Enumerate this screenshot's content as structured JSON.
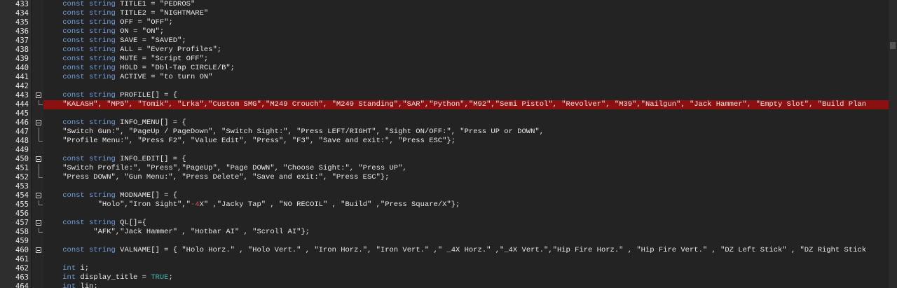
{
  "editor": {
    "lines": [
      {
        "num": "433",
        "fold": "",
        "hl": false,
        "parts": [
          {
            "t": "    ",
            "c": ""
          },
          {
            "t": "const string",
            "c": "kw"
          },
          {
            "t": " TITLE1 = \"PEDROS\"",
            "c": ""
          }
        ]
      },
      {
        "num": "434",
        "fold": "",
        "hl": false,
        "parts": [
          {
            "t": "    ",
            "c": ""
          },
          {
            "t": "const string",
            "c": "kw"
          },
          {
            "t": " TITLE2 = \"NIGHTMARE\"",
            "c": ""
          }
        ]
      },
      {
        "num": "435",
        "fold": "",
        "hl": false,
        "parts": [
          {
            "t": "    ",
            "c": ""
          },
          {
            "t": "const string",
            "c": "kw"
          },
          {
            "t": " OFF = \"OFF\";",
            "c": ""
          }
        ]
      },
      {
        "num": "436",
        "fold": "",
        "hl": false,
        "parts": [
          {
            "t": "    ",
            "c": ""
          },
          {
            "t": "const string",
            "c": "kw"
          },
          {
            "t": " ON = \"ON\";",
            "c": ""
          }
        ]
      },
      {
        "num": "437",
        "fold": "",
        "hl": false,
        "parts": [
          {
            "t": "    ",
            "c": ""
          },
          {
            "t": "const string",
            "c": "kw"
          },
          {
            "t": " SAVE = \"SAVED\";",
            "c": ""
          }
        ]
      },
      {
        "num": "438",
        "fold": "",
        "hl": false,
        "parts": [
          {
            "t": "    ",
            "c": ""
          },
          {
            "t": "const string",
            "c": "kw"
          },
          {
            "t": " ALL = \"Every Profiles\";",
            "c": ""
          }
        ]
      },
      {
        "num": "439",
        "fold": "",
        "hl": false,
        "parts": [
          {
            "t": "    ",
            "c": ""
          },
          {
            "t": "const string",
            "c": "kw"
          },
          {
            "t": " MUTE = \"Script OFF\";",
            "c": ""
          }
        ]
      },
      {
        "num": "440",
        "fold": "",
        "hl": false,
        "parts": [
          {
            "t": "    ",
            "c": ""
          },
          {
            "t": "const string",
            "c": "kw"
          },
          {
            "t": " HOLD = \"Dbl-Tap CIRCLE/B\";",
            "c": ""
          }
        ]
      },
      {
        "num": "441",
        "fold": "",
        "hl": false,
        "parts": [
          {
            "t": "    ",
            "c": ""
          },
          {
            "t": "const string",
            "c": "kw"
          },
          {
            "t": " ACTIVE = \"to turn ON\"",
            "c": ""
          }
        ]
      },
      {
        "num": "442",
        "fold": "",
        "hl": false,
        "parts": []
      },
      {
        "num": "443",
        "fold": "open",
        "hl": false,
        "parts": [
          {
            "t": "    ",
            "c": ""
          },
          {
            "t": "const string",
            "c": "kw"
          },
          {
            "t": " PROFILE[] = {",
            "c": ""
          }
        ]
      },
      {
        "num": "444",
        "fold": "end",
        "hl": true,
        "parts": [
          {
            "t": "    \"KALASH\", \"MP5\", \"Tomik\", \"Lrka\",\"Custom SMG\",\"M249 Crouch\", \"M249 Standing\",\"SAR\",\"Python\",\"M92\",\"Semi Pistol\", \"Revolver\", \"M39\",\"Nailgun\", \"Jack Hammer\", \"Empty Slot\", \"Build Plan",
            "c": ""
          }
        ]
      },
      {
        "num": "445",
        "fold": "",
        "hl": false,
        "parts": []
      },
      {
        "num": "446",
        "fold": "open",
        "hl": false,
        "parts": [
          {
            "t": "    ",
            "c": ""
          },
          {
            "t": "const string",
            "c": "kw"
          },
          {
            "t": " INFO_MENU[] = {",
            "c": ""
          }
        ]
      },
      {
        "num": "447",
        "fold": "line",
        "hl": false,
        "parts": [
          {
            "t": "    \"Switch Gun:\", \"PageUp / PageDown\", \"Switch Sight:\", \"Press LEFT/RIGHT\", \"Sight ON/OFF:\", \"Press UP or DOWN\",",
            "c": ""
          }
        ]
      },
      {
        "num": "448",
        "fold": "end",
        "hl": false,
        "parts": [
          {
            "t": "    \"Profile Menu:\", \"Press F2\", \"Value Edit\", \"Press\", \"F3\", \"Save and exit:\", \"Press ESC\"};",
            "c": ""
          }
        ]
      },
      {
        "num": "449",
        "fold": "",
        "hl": false,
        "parts": []
      },
      {
        "num": "450",
        "fold": "open",
        "hl": false,
        "parts": [
          {
            "t": "    ",
            "c": ""
          },
          {
            "t": "const string",
            "c": "kw"
          },
          {
            "t": " INFO_EDIT[] = {",
            "c": ""
          }
        ]
      },
      {
        "num": "451",
        "fold": "line",
        "hl": false,
        "parts": [
          {
            "t": "    \"Switch Profile:\", \"Press\",\"PageUp\", \"Page DOWN\", \"Choose Sight:\", \"Press UP\",",
            "c": ""
          }
        ]
      },
      {
        "num": "452",
        "fold": "end",
        "hl": false,
        "parts": [
          {
            "t": "    \"Press DOWN\", \"Gun Menu:\", \"Press Delete\", \"Save and exit:\", \"Press ESC\"};",
            "c": ""
          }
        ]
      },
      {
        "num": "453",
        "fold": "",
        "hl": false,
        "parts": []
      },
      {
        "num": "454",
        "fold": "open",
        "hl": false,
        "parts": [
          {
            "t": "    ",
            "c": ""
          },
          {
            "t": "const string",
            "c": "kw"
          },
          {
            "t": " MODNAME[] = {",
            "c": ""
          }
        ]
      },
      {
        "num": "455",
        "fold": "end",
        "hl": false,
        "parts": [
          {
            "t": "            \"Holo\",\"Iron Sight\",\"",
            "c": ""
          },
          {
            "t": "-4",
            "c": "red"
          },
          {
            "t": "X\" ,\"Jacky Tap\" , \"NO RECOIL\" , \"Build\" ,\"Press Square/X\"};",
            "c": ""
          }
        ]
      },
      {
        "num": "456",
        "fold": "",
        "hl": false,
        "parts": []
      },
      {
        "num": "457",
        "fold": "open",
        "hl": false,
        "parts": [
          {
            "t": "    ",
            "c": ""
          },
          {
            "t": "const string",
            "c": "kw"
          },
          {
            "t": " QL[]={",
            "c": ""
          }
        ]
      },
      {
        "num": "458",
        "fold": "end",
        "hl": false,
        "parts": [
          {
            "t": "           \"AFK\",\"Jack Hammer\" , \"Hotbar AI\" , \"Scroll AI\"};",
            "c": ""
          }
        ]
      },
      {
        "num": "459",
        "fold": "",
        "hl": false,
        "parts": []
      },
      {
        "num": "460",
        "fold": "open",
        "hl": false,
        "parts": [
          {
            "t": "    ",
            "c": ""
          },
          {
            "t": "const string",
            "c": "kw"
          },
          {
            "t": " VALNAME[] = { \"Holo Horz.\" , \"Holo Vert.\" , \"Iron Horz.\", \"Iron Vert.\" ,\" _4X Horz.\" ,\"_4X Vert.\",\"Hip Fire Horz.\" , \"Hip Fire Vert.\" , \"DZ Left Stick\" , \"DZ Right Stick",
            "c": ""
          }
        ]
      },
      {
        "num": "461",
        "fold": "",
        "hl": false,
        "parts": []
      },
      {
        "num": "462",
        "fold": "",
        "hl": false,
        "parts": [
          {
            "t": "    ",
            "c": ""
          },
          {
            "t": "int",
            "c": "kw"
          },
          {
            "t": " i;",
            "c": ""
          }
        ]
      },
      {
        "num": "463",
        "fold": "",
        "hl": false,
        "parts": [
          {
            "t": "    ",
            "c": ""
          },
          {
            "t": "int",
            "c": "kw"
          },
          {
            "t": " display_title = ",
            "c": ""
          },
          {
            "t": "TRUE",
            "c": "tl"
          },
          {
            "t": ";",
            "c": ""
          }
        ]
      },
      {
        "num": "464",
        "fold": "",
        "hl": false,
        "parts": [
          {
            "t": "    ",
            "c": ""
          },
          {
            "t": "int",
            "c": "kw"
          },
          {
            "t": " lin;",
            "c": ""
          }
        ]
      }
    ]
  },
  "colors": {
    "background": "#232323",
    "keyword": "#6f9fe0",
    "highlight": "#8c1010",
    "constant": "#3fb7b0"
  }
}
